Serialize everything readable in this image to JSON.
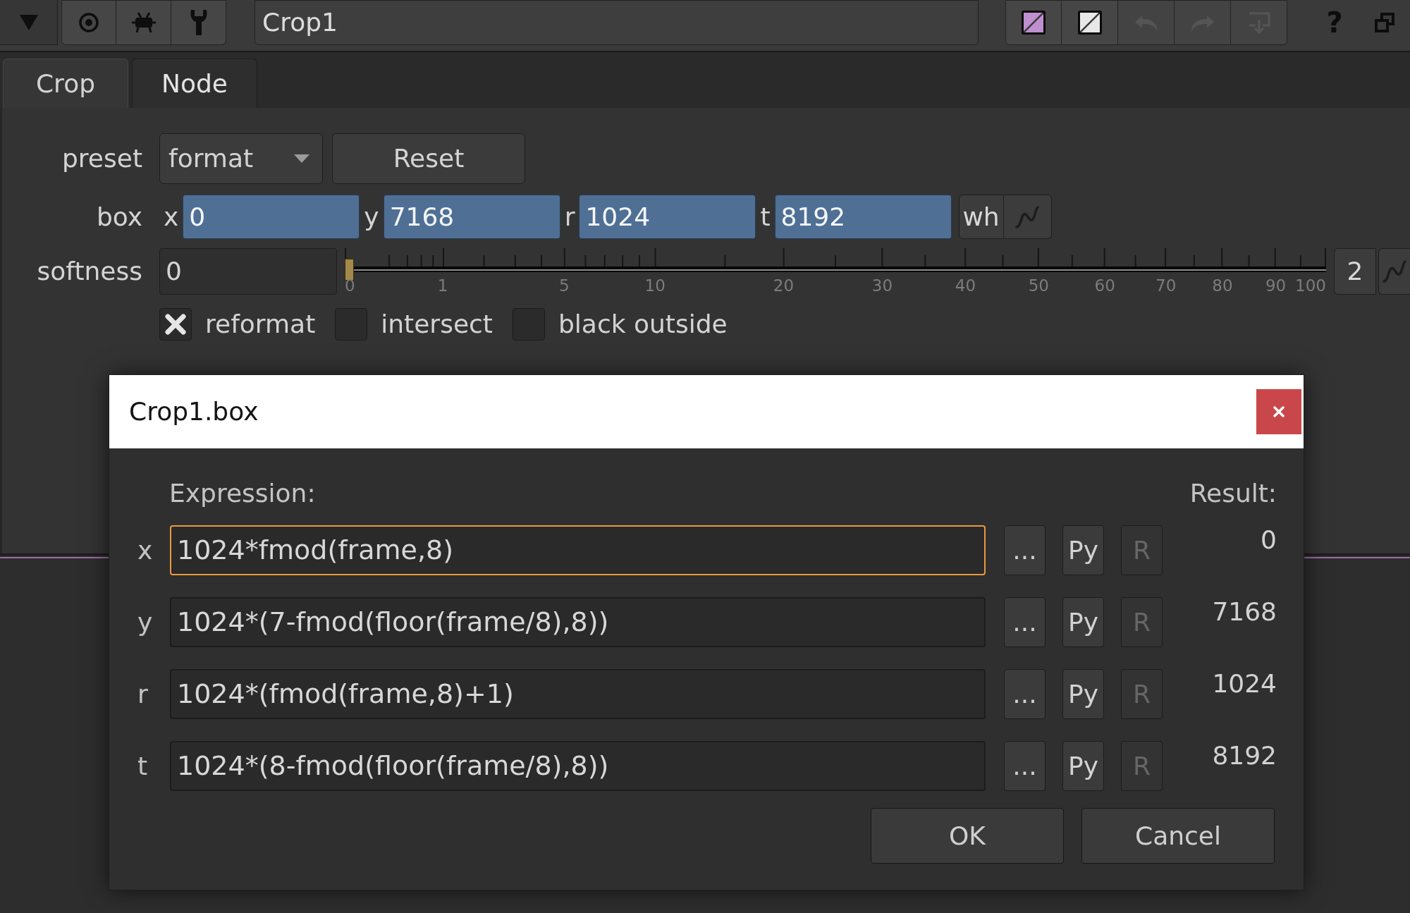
{
  "toolbar": {
    "node_name": "Crop1",
    "swatches": [
      {
        "color": "#c08fd0"
      },
      {
        "color": "#e8e8e8"
      }
    ],
    "history_buttons": [
      {
        "kind": "undo",
        "disabled": true
      },
      {
        "kind": "redo",
        "disabled": true
      },
      {
        "kind": "revert",
        "disabled": true
      }
    ],
    "help_label": "?"
  },
  "tabs": [
    {
      "label": "Crop",
      "selected": true
    },
    {
      "label": "Node",
      "selected": false
    }
  ],
  "knobs": {
    "preset": {
      "label": "preset",
      "value": "format",
      "button": "Reset"
    },
    "box": {
      "label": "box",
      "fields": [
        {
          "label": "x",
          "value": "0",
          "expression": true
        },
        {
          "label": "y",
          "value": "7168",
          "expression": true
        },
        {
          "label": "r",
          "value": "1024",
          "expression": true
        },
        {
          "label": "t",
          "value": "8192",
          "expression": true
        }
      ],
      "button": "wh"
    },
    "softness": {
      "label": "softness",
      "value": "0",
      "level": 0,
      "ticks": [
        "0",
        "1",
        "5",
        "10",
        "20",
        "30",
        "40",
        "50",
        "60",
        "70",
        "80",
        "90",
        "100"
      ],
      "button": "2"
    },
    "options": [
      {
        "label": "reformat",
        "checked": true
      },
      {
        "label": "intersect",
        "checked": false
      },
      {
        "label": "black outside",
        "checked": false
      }
    ]
  },
  "dialog": {
    "title": "Crop1.box",
    "expression_header": "Expression:",
    "result_header": "Result:",
    "rows": [
      {
        "label": "x",
        "expression": "1024*fmod(frame,8)",
        "focused": true,
        "buttons": [
          {
            "label": "...",
            "disabled": false
          },
          {
            "label": "Py",
            "disabled": false
          },
          {
            "label": "R",
            "disabled": true
          }
        ],
        "result": "0"
      },
      {
        "label": "y",
        "expression": "1024*(7-fmod(floor(frame/8),8))",
        "focused": false,
        "buttons": [
          {
            "label": "...",
            "disabled": false
          },
          {
            "label": "Py",
            "disabled": false
          },
          {
            "label": "R",
            "disabled": true
          }
        ],
        "result": "7168"
      },
      {
        "label": "r",
        "expression": "1024*(fmod(frame,8)+1)",
        "focused": false,
        "buttons": [
          {
            "label": "...",
            "disabled": false
          },
          {
            "label": "Py",
            "disabled": false
          },
          {
            "label": "R",
            "disabled": true
          }
        ],
        "result": "1024"
      },
      {
        "label": "t",
        "expression": "1024*(8-fmod(floor(frame/8),8))",
        "focused": false,
        "buttons": [
          {
            "label": "...",
            "disabled": false
          },
          {
            "label": "Py",
            "disabled": false
          },
          {
            "label": "R",
            "disabled": true
          }
        ],
        "result": "8192"
      }
    ],
    "buttons": [
      {
        "label": "OK"
      },
      {
        "label": "Cancel"
      }
    ]
  }
}
